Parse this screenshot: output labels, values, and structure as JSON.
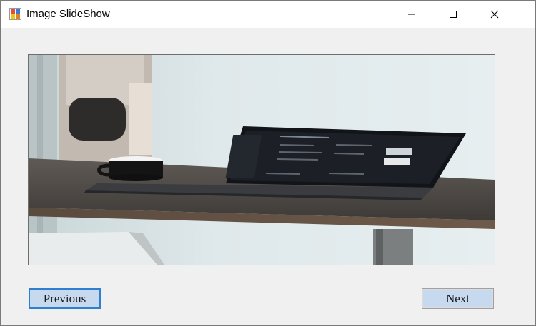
{
  "window": {
    "title": "Image SlideShow",
    "icon": "windows-forms-app-icon",
    "controls": [
      "minimize-icon",
      "maximize-icon",
      "close-icon"
    ]
  },
  "slideshow": {
    "image_alt": "photo of a laptop and a mug on a wooden desk"
  },
  "buttons": {
    "previous_label": "Previous",
    "next_label": "Next"
  },
  "colors": {
    "client_background": "#f0f0f0",
    "button_fill": "#c7d9ef",
    "focus_border": "#2f7fd0"
  }
}
